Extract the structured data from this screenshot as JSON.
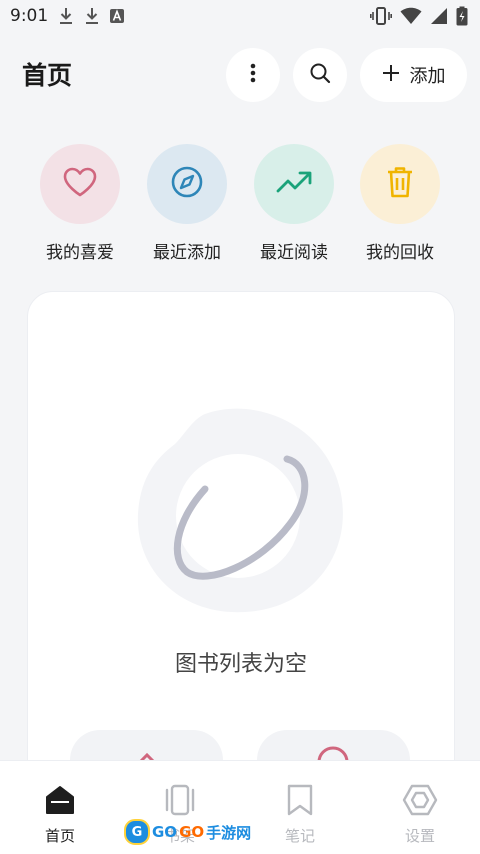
{
  "status_bar": {
    "time": "9:01",
    "icons": [
      "download-icon",
      "download-icon",
      "text-a-icon",
      "vibrate-icon",
      "wifi-icon",
      "signal-icon",
      "battery-charging-icon"
    ]
  },
  "header": {
    "title": "首页",
    "more_icon": "more-vertical-icon",
    "search_icon": "search-icon",
    "add_label": "添加"
  },
  "quick_actions": [
    {
      "label": "我的喜爱",
      "icon": "heart-icon",
      "bg": "#f3e1e6",
      "color": "#d0667e"
    },
    {
      "label": "最近添加",
      "icon": "compass-icon",
      "bg": "#dce8f1",
      "color": "#2e86b8"
    },
    {
      "label": "最近阅读",
      "icon": "trending-up-icon",
      "bg": "#d8efe9",
      "color": "#1aa37a"
    },
    {
      "label": "我的回收",
      "icon": "trash-icon",
      "bg": "#fbefd6",
      "color": "#f0b400"
    }
  ],
  "empty_state": {
    "text": "图书列表为空",
    "illustration": "planet-icon"
  },
  "bottom_nav": [
    {
      "label": "首页",
      "icon": "home-icon",
      "active": true
    },
    {
      "label": "书架",
      "icon": "books-icon",
      "active": false
    },
    {
      "label": "笔记",
      "icon": "bookmark-icon",
      "active": false
    },
    {
      "label": "设置",
      "icon": "hexagon-settings-icon",
      "active": false
    }
  ],
  "watermark": {
    "text_blue": "GO",
    "text_orange": "GO",
    "text_tail": "手游网"
  },
  "colors": {
    "background": "#f4f5f7",
    "card": "#ffffff",
    "nav_active": "#1e1e1e",
    "nav_inactive": "#b7b9be"
  }
}
